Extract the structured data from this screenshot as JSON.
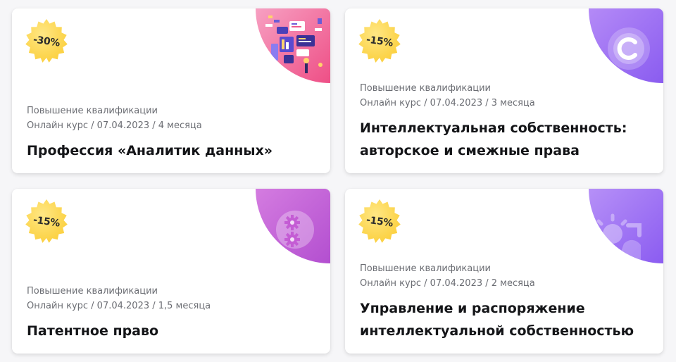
{
  "colors": {
    "card_background": "#ffffff",
    "page_background": "#f6f6f8",
    "badge_gold": "#fcd44a",
    "title_text": "#141518",
    "meta_text": "#6b6d73"
  },
  "courses": [
    {
      "discount": "-30%",
      "category": "Повышение квалификации",
      "meta": "Онлайн курс / 07.04.2023 / 4 месяца",
      "title_lines": [
        "Профессия «Аналитик данных»"
      ],
      "corner_icon": "data-analytics-illustration",
      "corner_color": "#f05a8c"
    },
    {
      "discount": "-15%",
      "category": "Повышение квалификации",
      "meta": "Онлайн курс / 07.04.2023 / 3 месяца",
      "title_lines": [
        "Интеллектуальная собственность:",
        "авторское и смежные права"
      ],
      "corner_icon": "copyright-icon",
      "corner_color": "#9b6bf2"
    },
    {
      "discount": "-15%",
      "category": "Повышение квалификации",
      "meta": "Онлайн курс / 07.04.2023 / 1,5 месяца",
      "title_lines": [
        "Патентное право"
      ],
      "corner_icon": "gears-icon",
      "corner_color": "#c55fd6"
    },
    {
      "discount": "-15%",
      "category": "Повышение квалификации",
      "meta": "Онлайн курс / 07.04.2023 / 2 месяца",
      "title_lines": [
        "Управление и распоряжение",
        "интеллектуальной собственностью"
      ],
      "corner_icon": "sun-icon",
      "corner_color": "#9c6cf3"
    }
  ]
}
